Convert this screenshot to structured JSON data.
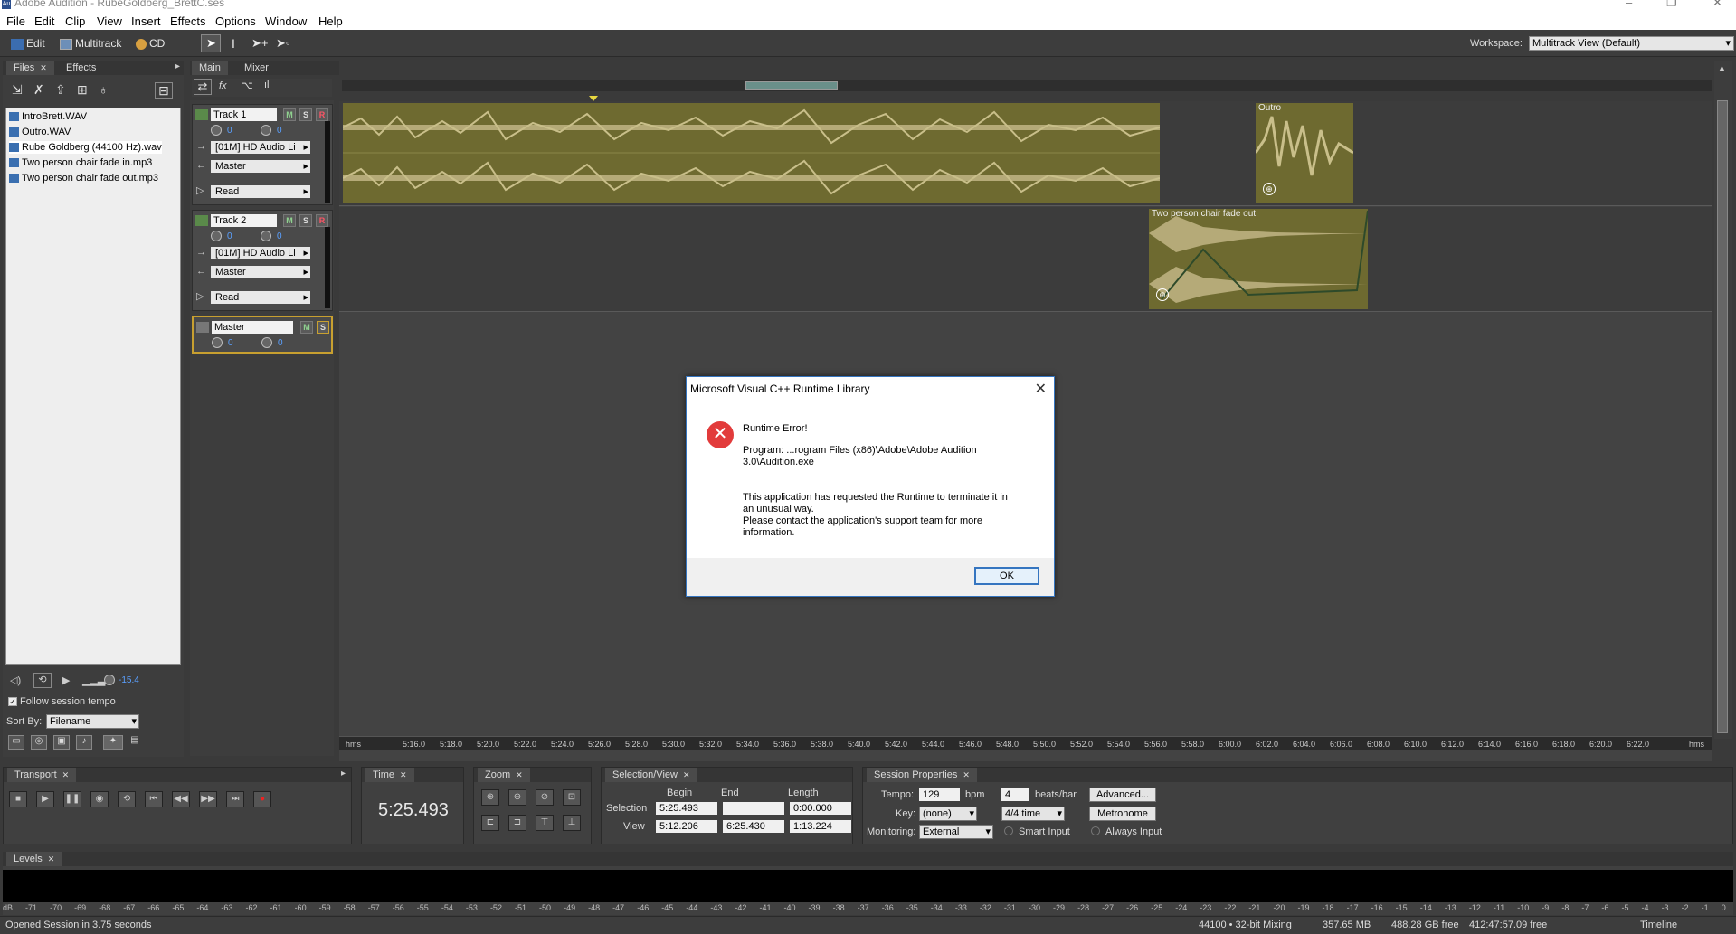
{
  "window": {
    "title": "Adobe Audition - RubeGoldberg_BrettC.ses",
    "app_icon": "Au"
  },
  "menu": [
    "File",
    "Edit",
    "Clip",
    "View",
    "Insert",
    "Effects",
    "Options",
    "Window",
    "Help"
  ],
  "toolbar": {
    "edit_label": "Edit",
    "multitrack_label": "Multitrack",
    "cd_label": "CD",
    "workspace_label": "Workspace:",
    "workspace_value": "Multitrack View (Default)"
  },
  "files_panel": {
    "tabs": [
      "Files",
      "Effects"
    ],
    "files": [
      "IntroBrett.WAV",
      "Outro.WAV",
      "Rube Goldberg (44100 Hz).wav",
      "Two person chair fade in.mp3",
      "Two person chair fade out.mp3"
    ],
    "volume_value": "-15.4",
    "follow_tempo_label": "Follow session tempo",
    "sort_label": "Sort By:",
    "sort_value": "Filename"
  },
  "view_tabs": [
    "Main",
    "Mixer"
  ],
  "tracks": [
    {
      "name": "Track 1",
      "vol": "0",
      "pan": "0",
      "input": "[01M] HD Audio Li",
      "output": "Master",
      "automation": "Read"
    },
    {
      "name": "Track 2",
      "vol": "0",
      "pan": "0",
      "input": "[01M] HD Audio Li",
      "output": "Master",
      "automation": "Read"
    },
    {
      "name": "Master",
      "vol": "0",
      "pan": "0"
    }
  ],
  "clips": {
    "outro": "Outro",
    "chair_fade_out": "Two person chair fade out"
  },
  "ruler": {
    "left": "hms",
    "right": "hms",
    "ticks": [
      "5:16.0",
      "5:18.0",
      "5:20.0",
      "5:22.0",
      "5:24.0",
      "5:26.0",
      "5:28.0",
      "5:30.0",
      "5:32.0",
      "5:34.0",
      "5:36.0",
      "5:38.0",
      "5:40.0",
      "5:42.0",
      "5:44.0",
      "5:46.0",
      "5:48.0",
      "5:50.0",
      "5:52.0",
      "5:54.0",
      "5:56.0",
      "5:58.0",
      "6:00.0",
      "6:02.0",
      "6:04.0",
      "6:06.0",
      "6:08.0",
      "6:10.0",
      "6:12.0",
      "6:14.0",
      "6:16.0",
      "6:18.0",
      "6:20.0",
      "6:22.0"
    ]
  },
  "dialog": {
    "title": "Microsoft Visual C++ Runtime Library",
    "heading": "Runtime Error!",
    "program_line1": "Program: ...rogram Files (x86)\\Adobe\\Adobe Audition",
    "program_line2": "3.0\\Audition.exe",
    "body_line1": "This application has requested the Runtime to terminate it in",
    "body_line2": "an unusual way.",
    "body_line3": "Please contact the application's support team for more",
    "body_line4": "information.",
    "ok_label": "OK"
  },
  "transport": {
    "title": "Transport"
  },
  "time": {
    "title": "Time",
    "value": "5:25.493"
  },
  "zoom": {
    "title": "Zoom"
  },
  "selection_view": {
    "title": "Selection/View",
    "headers": [
      "Begin",
      "End",
      "Length"
    ],
    "selection_label": "Selection",
    "view_label": "View",
    "selection": [
      "5:25.493",
      "",
      "0:00.000"
    ],
    "view": [
      "5:12.206",
      "6:25.430",
      "1:13.224"
    ]
  },
  "session": {
    "title": "Session Properties",
    "tempo_label": "Tempo:",
    "tempo": "129",
    "bpm": "bpm",
    "beats": "4",
    "beats_label": "beats/bar",
    "advanced": "Advanced...",
    "key_label": "Key:",
    "key": "(none)",
    "time_sig": "4/4 time",
    "metronome": "Metronome",
    "monitoring_label": "Monitoring:",
    "monitoring": "External",
    "smart_input": "Smart Input",
    "always_input": "Always Input"
  },
  "levels": {
    "title": "Levels",
    "scale": [
      "dB",
      "-71",
      "-70",
      "-69",
      "-68",
      "-67",
      "-66",
      "-65",
      "-64",
      "-63",
      "-62",
      "-61",
      "-60",
      "-59",
      "-58",
      "-57",
      "-56",
      "-55",
      "-54",
      "-53",
      "-52",
      "-51",
      "-50",
      "-49",
      "-48",
      "-47",
      "-46",
      "-45",
      "-44",
      "-43",
      "-42",
      "-41",
      "-40",
      "-39",
      "-38",
      "-37",
      "-36",
      "-35",
      "-34",
      "-33",
      "-32",
      "-31",
      "-30",
      "-29",
      "-28",
      "-27",
      "-26",
      "-25",
      "-24",
      "-23",
      "-22",
      "-21",
      "-20",
      "-19",
      "-18",
      "-17",
      "-16",
      "-15",
      "-14",
      "-13",
      "-12",
      "-11",
      "-10",
      "-9",
      "-8",
      "-7",
      "-6",
      "-5",
      "-4",
      "-3",
      "-2",
      "-1",
      "0"
    ]
  },
  "status": {
    "left": "Opened Session in 3.75 seconds",
    "mix": "44100 • 32-bit Mixing",
    "mem": "357.65 MB",
    "disk": "488.28 GB free",
    "time_free": "412:47:57.09 free",
    "mode": "Timeline"
  }
}
